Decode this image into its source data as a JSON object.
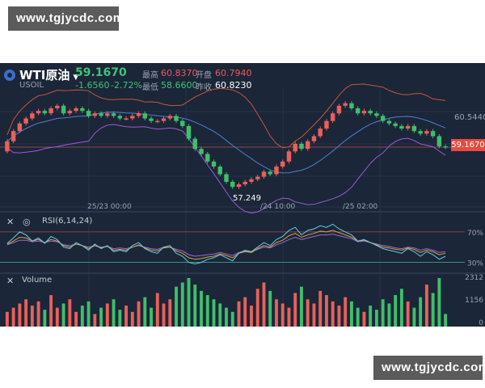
{
  "watermarks": {
    "top": "www.tgjycdc.com",
    "bottom": "www.tgjycdc.com"
  },
  "header": {
    "symbol": "WTI原油",
    "sub_symbol": "USOIL",
    "last_price": "59.1670",
    "change": "-1.6560",
    "change_pct": "-2.72%",
    "high_label": "最高",
    "high": "60.8370",
    "low_label": "最低",
    "low": "58.6600",
    "open_label": "开盘",
    "open": "60.7940",
    "prev_close_label": "昨收",
    "prev_close": "60.8230"
  },
  "price_axis": {
    "upper_label": "60.5440",
    "current_tag": "59.1670",
    "min_marker": "57.249"
  },
  "time_labels": [
    "25/23 00:00",
    "/24 10:00",
    "/25 02:00"
  ],
  "rsi": {
    "title": "RSI(6,14,24)",
    "levels": [
      "70%",
      "30%"
    ]
  },
  "volume": {
    "title": "Volume",
    "levels": [
      "2312",
      "1156",
      "0"
    ]
  },
  "colors": {
    "up": "#e8615a",
    "down": "#3fbf6a",
    "bg": "#1b2638",
    "boll_upper": "#c4583c",
    "boll_mid": "#4f7fd6",
    "boll_lower": "#9b5ad8"
  },
  "chart_data": {
    "type": "candlestick",
    "open": [
      59.0,
      59.4,
      59.8,
      60.1,
      60.3,
      60.5,
      60.6,
      60.5,
      60.7,
      60.8,
      60.5,
      60.6,
      60.7,
      60.6,
      60.4,
      60.5,
      60.4,
      60.5,
      60.4,
      60.3,
      60.3,
      60.4,
      60.5,
      60.3,
      60.2,
      60.2,
      60.3,
      60.4,
      60.2,
      60.0,
      59.5,
      59.1,
      58.9,
      58.6,
      58.4,
      58.1,
      57.8,
      57.6,
      57.7,
      57.8,
      57.9,
      58.0,
      58.2,
      58.1,
      58.4,
      58.6,
      59.0,
      59.3,
      59.1,
      59.4,
      59.6,
      59.9,
      60.2,
      60.5,
      60.8,
      60.9,
      60.7,
      60.5,
      60.6,
      60.5,
      60.4,
      60.2,
      60.1,
      60.0,
      59.9,
      60.0,
      59.8,
      59.7,
      59.8,
      59.6,
      59.2
    ],
    "close": [
      59.4,
      59.8,
      60.1,
      60.3,
      60.5,
      60.6,
      60.5,
      60.7,
      60.8,
      60.5,
      60.6,
      60.7,
      60.6,
      60.4,
      60.5,
      60.4,
      60.5,
      60.4,
      60.3,
      60.3,
      60.4,
      60.5,
      60.3,
      60.2,
      60.2,
      60.3,
      60.4,
      60.2,
      60.0,
      59.5,
      59.1,
      58.9,
      58.6,
      58.4,
      58.1,
      57.8,
      57.6,
      57.7,
      57.8,
      57.9,
      58.0,
      58.2,
      58.1,
      58.4,
      58.6,
      59.0,
      59.3,
      59.1,
      59.4,
      59.6,
      59.9,
      60.2,
      60.5,
      60.8,
      60.9,
      60.7,
      60.5,
      60.6,
      60.5,
      60.4,
      60.2,
      60.1,
      60.0,
      59.9,
      60.0,
      59.8,
      59.7,
      59.8,
      59.6,
      59.2,
      59.17
    ],
    "ylim": [
      57.0,
      61.4
    ],
    "volume": [
      700,
      900,
      1100,
      1300,
      1000,
      1200,
      800,
      1500,
      900,
      1100,
      1300,
      700,
      1000,
      1200,
      600,
      900,
      1100,
      1300,
      800,
      1000,
      700,
      1200,
      1400,
      900,
      1600,
      1100,
      1300,
      1900,
      2100,
      2312,
      2000,
      1700,
      1500,
      1300,
      1100,
      900,
      700,
      1200,
      1400,
      1000,
      1800,
      2100,
      1700,
      1300,
      1100,
      900,
      1600,
      1900,
      1300,
      1100,
      1700,
      1500,
      1200,
      1000,
      1400,
      1200,
      900,
      700,
      1000,
      800,
      1300,
      1100,
      1500,
      1800,
      1200,
      900,
      1400,
      2000,
      1600,
      2312,
      600
    ],
    "rsi6": [
      55,
      62,
      70,
      66,
      58,
      62,
      55,
      64,
      60,
      50,
      48,
      56,
      52,
      46,
      54,
      48,
      52,
      44,
      46,
      44,
      52,
      56,
      48,
      44,
      42,
      50,
      52,
      42,
      38,
      30,
      28,
      30,
      34,
      36,
      40,
      36,
      32,
      42,
      46,
      44,
      50,
      56,
      52,
      60,
      64,
      72,
      76,
      66,
      72,
      74,
      78,
      76,
      80,
      74,
      70,
      66,
      58,
      60,
      56,
      52,
      48,
      46,
      44,
      42,
      48,
      44,
      38,
      44,
      40,
      34,
      38
    ],
    "rsi14": [
      54,
      58,
      63,
      62,
      58,
      60,
      56,
      60,
      58,
      52,
      50,
      54,
      52,
      48,
      52,
      49,
      51,
      46,
      47,
      46,
      50,
      53,
      49,
      46,
      45,
      49,
      50,
      45,
      42,
      36,
      34,
      35,
      37,
      38,
      41,
      39,
      36,
      42,
      44,
      43,
      48,
      52,
      50,
      56,
      59,
      65,
      68,
      63,
      66,
      68,
      71,
      70,
      72,
      69,
      66,
      63,
      58,
      59,
      56,
      53,
      50,
      49,
      47,
      46,
      49,
      47,
      43,
      46,
      44,
      40,
      42
    ],
    "rsi24": [
      53,
      56,
      59,
      59,
      57,
      58,
      56,
      58,
      57,
      53,
      52,
      54,
      52,
      50,
      52,
      50,
      51,
      48,
      49,
      48,
      50,
      52,
      50,
      48,
      47,
      50,
      50,
      47,
      45,
      40,
      38,
      39,
      40,
      41,
      43,
      41,
      39,
      43,
      45,
      44,
      47,
      50,
      49,
      53,
      56,
      60,
      63,
      60,
      62,
      64,
      66,
      66,
      67,
      65,
      63,
      61,
      57,
      58,
      56,
      54,
      52,
      51,
      49,
      48,
      50,
      49,
      46,
      48,
      46,
      43,
      44
    ]
  }
}
